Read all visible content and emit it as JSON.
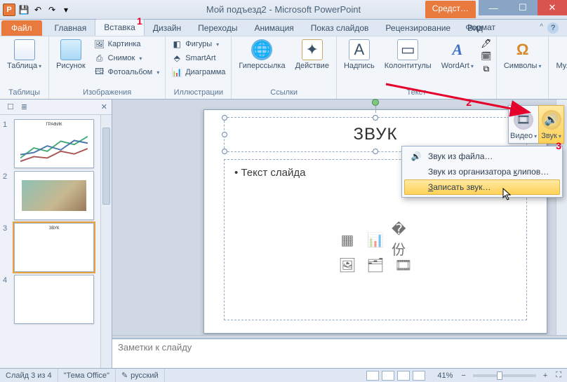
{
  "title": "Мой подъезд2 - Microsoft PowerPoint",
  "quickAccess": {
    "save": "💾",
    "undo": "↶",
    "redo": "↷",
    "dd": "▾"
  },
  "toolTab": "Средст…",
  "tabs": {
    "file": "Файл",
    "home": "Главная",
    "insert": "Вставка",
    "design": "Дизайн",
    "transitions": "Переходы",
    "animations": "Анимация",
    "slideshow": "Показ слайдов",
    "review": "Рецензирование",
    "view": "Вид",
    "format": "Формат"
  },
  "ribbon": {
    "tables": {
      "label": "Таблицы",
      "table": "Таблица"
    },
    "images": {
      "label": "Изображения",
      "picture": "Рисунок",
      "clipart": "Картинка",
      "screenshot": "Снимок",
      "album": "Фотоальбом"
    },
    "illus": {
      "label": "Иллюстрации",
      "shapes": "Фигуры",
      "smartart": "SmartArt",
      "chart": "Диаграмма"
    },
    "links": {
      "label": "Ссылки",
      "hyperlink": "Гиперссылка",
      "action": "Действие"
    },
    "text": {
      "label": "Текст",
      "textbox": "Надпись",
      "headerfooter": "Колонтитулы",
      "wordart": "WordArt"
    },
    "symbols": {
      "label": "",
      "symbols": "Символы"
    },
    "media": {
      "label": "",
      "media": "Мультимедиа"
    }
  },
  "badges": {
    "b1": "1",
    "b2": "2",
    "b3": "3"
  },
  "thumbs": {
    "tab1": "☐",
    "tab2": "≣",
    "close": "✕",
    "items": [
      {
        "n": "1",
        "title": "ГРАФИК"
      },
      {
        "n": "2",
        "title": ""
      },
      {
        "n": "3",
        "title": "ЗВУК"
      },
      {
        "n": "4",
        "title": ""
      }
    ]
  },
  "slide": {
    "title": "ЗВУК",
    "body": "Текст слайда"
  },
  "flyout": {
    "video": "Видео",
    "sound": "Звук"
  },
  "menu": {
    "fromFile": "Звук из файла…",
    "fromOrganizer_pre": "Звук из организатора ",
    "fromOrganizer_u": "к",
    "fromOrganizer_post": "липов…",
    "record_u": "З",
    "record_post": "аписать звук…"
  },
  "notes": "Заметки к слайду",
  "status": {
    "slide": "Слайд 3 из 4",
    "theme": "\"Тема Office\"",
    "lang": "русский",
    "zoom": "41%",
    "fit": "⛶",
    "minus": "−",
    "plus": "+"
  }
}
